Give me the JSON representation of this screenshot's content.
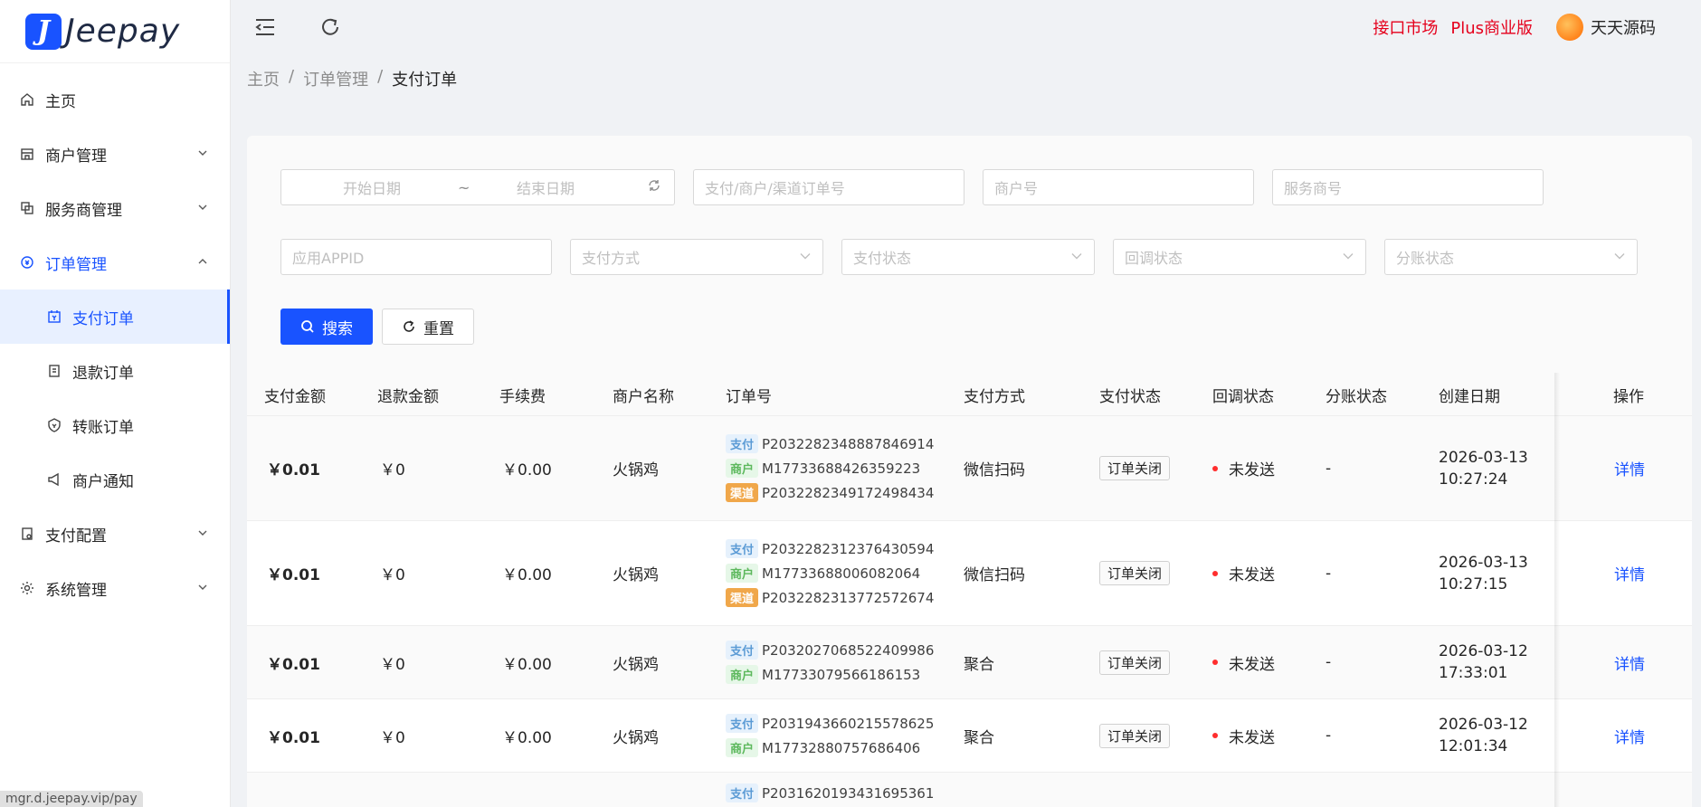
{
  "brand": {
    "name": "Jeepay",
    "mark": "J"
  },
  "sidebar": {
    "items": [
      {
        "label": "主页",
        "icon": "home-icon"
      },
      {
        "label": "商户管理",
        "icon": "shop-icon"
      },
      {
        "label": "服务商管理",
        "icon": "copy-icon"
      },
      {
        "label": "订单管理",
        "icon": "account-book-icon"
      },
      {
        "label": "支付订单",
        "icon": "pay-order-icon"
      },
      {
        "label": "退款订单",
        "icon": "refund-icon"
      },
      {
        "label": "转账订单",
        "icon": "shield-icon"
      },
      {
        "label": "商户通知",
        "icon": "notification-icon"
      },
      {
        "label": "支付配置",
        "icon": "setting-file-icon"
      },
      {
        "label": "系统管理",
        "icon": "gear-icon"
      }
    ]
  },
  "header": {
    "links": [
      "接口市场",
      "Plus商业版"
    ],
    "user": "天天源码"
  },
  "breadcrumb": [
    "主页",
    "订单管理",
    "支付订单"
  ],
  "filters": {
    "start_date": "开始日期",
    "end_date": "结束日期",
    "tilde": "~",
    "order_no": "支付/商户/渠道订单号",
    "mch_no": "商户号",
    "isv_no": "服务商号",
    "app_id": "应用APPID",
    "pay_way": "支付方式",
    "pay_state": "支付状态",
    "notify_state": "回调状态",
    "division_state": "分账状态",
    "search": "搜索",
    "reset": "重置"
  },
  "table": {
    "columns": [
      "支付金额",
      "退款金额",
      "手续费",
      "商户名称",
      "订单号",
      "支付方式",
      "支付状态",
      "回调状态",
      "分账状态",
      "创建日期",
      "操作"
    ],
    "rows": [
      {
        "amount": "￥0.01",
        "refund": "￥0",
        "fee": "￥0.00",
        "mch_name": "火锅鸡",
        "pay_no": "P2032282348887846914",
        "mch_no": "M17733688426359223",
        "chn_no": "P2032282349172498434",
        "way": "微信扫码",
        "state": "订单关闭",
        "notify": "未发送",
        "division": "-",
        "date": "2026-03-13",
        "time": "10:27:24",
        "action": "详情"
      },
      {
        "amount": "￥0.01",
        "refund": "￥0",
        "fee": "￥0.00",
        "mch_name": "火锅鸡",
        "pay_no": "P2032282312376430594",
        "mch_no": "M17733688006082064",
        "chn_no": "P2032282313772572674",
        "way": "微信扫码",
        "state": "订单关闭",
        "notify": "未发送",
        "division": "-",
        "date": "2026-03-13",
        "time": "10:27:15",
        "action": "详情"
      },
      {
        "amount": "￥0.01",
        "refund": "￥0",
        "fee": "￥0.00",
        "mch_name": "火锅鸡",
        "pay_no": "P2032027068522409986",
        "mch_no": "M17733079566186153",
        "chn_no": "",
        "way": "聚合",
        "state": "订单关闭",
        "notify": "未发送",
        "division": "-",
        "date": "2026-03-12",
        "time": "17:33:01",
        "action": "详情"
      },
      {
        "amount": "￥0.01",
        "refund": "￥0",
        "fee": "￥0.00",
        "mch_name": "火锅鸡",
        "pay_no": "P2031943660215578625",
        "mch_no": "M17732880757686406",
        "chn_no": "",
        "way": "聚合",
        "state": "订单关闭",
        "notify": "未发送",
        "division": "-",
        "date": "2026-03-12",
        "time": "12:01:34",
        "action": "详情"
      },
      {
        "amount": "",
        "refund": "",
        "fee": "",
        "mch_name": "",
        "pay_no": "P2031620193431695361",
        "mch_no": "",
        "chn_no": "",
        "way": "",
        "state": "",
        "notify": "",
        "division": "",
        "date": "",
        "time": "",
        "action": ""
      }
    ]
  },
  "tags": {
    "pay": "支付",
    "mch": "商户",
    "chn": "渠道"
  },
  "status_url": "mgr.d.jeepay.vip/pay"
}
